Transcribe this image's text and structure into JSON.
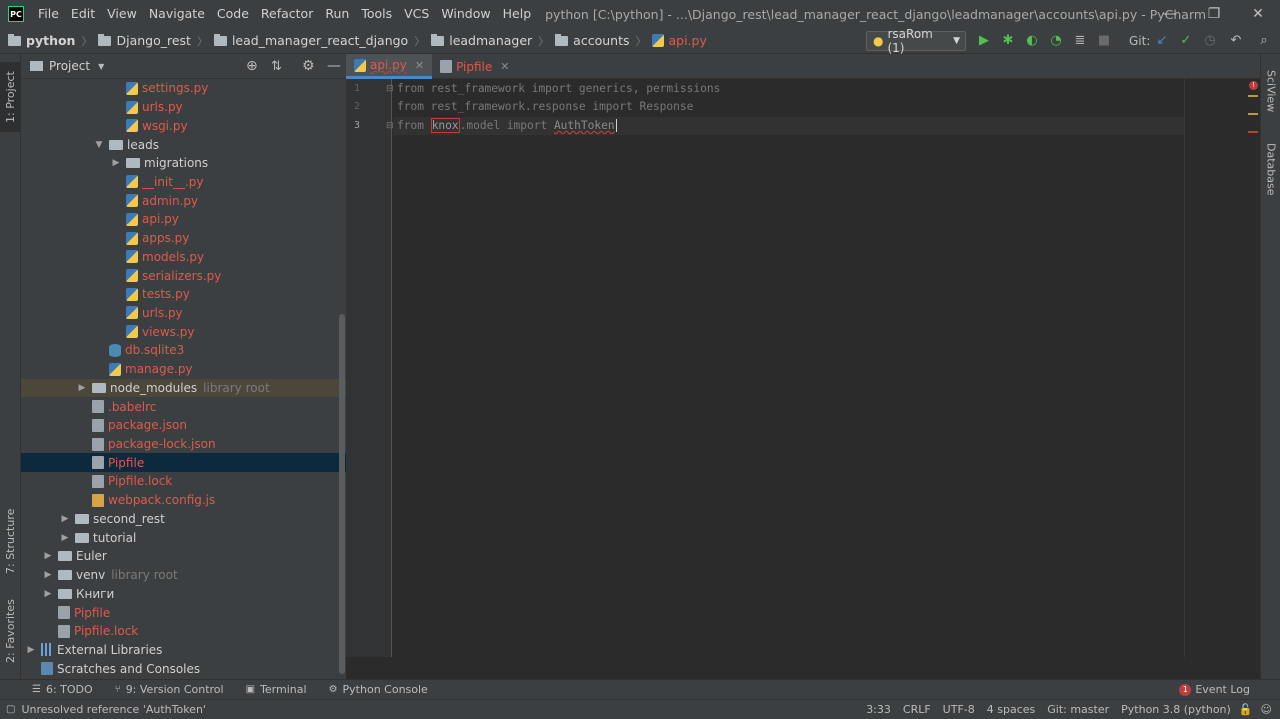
{
  "window": {
    "logo": "PC",
    "title": "python [C:\\python] - ...\\Django_rest\\lead_manager_react_django\\leadmanager\\accounts\\api.py - PyCharm",
    "minimize": "—",
    "restore": "❐",
    "close": "✕"
  },
  "menu": [
    "File",
    "Edit",
    "View",
    "Navigate",
    "Code",
    "Refactor",
    "Run",
    "Tools",
    "VCS",
    "Window",
    "Help"
  ],
  "breadcrumbs": [
    "python",
    "Django_rest",
    "lead_manager_react_django",
    "leadmanager",
    "accounts",
    "api.py"
  ],
  "toolbar": {
    "run_config": "rsaRom (1)",
    "git_label": "Git:"
  },
  "side_tabs": {
    "project": "1: Project",
    "structure": "7: Structure",
    "favorites": "2: Favorites",
    "sciview": "SciView",
    "database": "Database"
  },
  "project_panel": {
    "title": "Project"
  },
  "tree": [
    {
      "label": "settings.py",
      "icon": "py",
      "color": "red",
      "indent": 5,
      "arrow": ""
    },
    {
      "label": "urls.py",
      "icon": "py",
      "color": "red",
      "indent": 5,
      "arrow": ""
    },
    {
      "label": "wsgi.py",
      "icon": "py",
      "color": "red",
      "indent": 5,
      "arrow": ""
    },
    {
      "label": "leads",
      "icon": "folder",
      "color": "white",
      "indent": 4,
      "arrow": "▼"
    },
    {
      "label": "migrations",
      "icon": "folder",
      "color": "white",
      "indent": 5,
      "arrow": "▶"
    },
    {
      "label": "__init__.py",
      "icon": "py",
      "color": "red",
      "indent": 5,
      "arrow": ""
    },
    {
      "label": "admin.py",
      "icon": "py",
      "color": "red",
      "indent": 5,
      "arrow": ""
    },
    {
      "label": "api.py",
      "icon": "py",
      "color": "red",
      "indent": 5,
      "arrow": ""
    },
    {
      "label": "apps.py",
      "icon": "py",
      "color": "red",
      "indent": 5,
      "arrow": ""
    },
    {
      "label": "models.py",
      "icon": "py",
      "color": "red",
      "indent": 5,
      "arrow": ""
    },
    {
      "label": "serializers.py",
      "icon": "py",
      "color": "red",
      "indent": 5,
      "arrow": ""
    },
    {
      "label": "tests.py",
      "icon": "py",
      "color": "red",
      "indent": 5,
      "arrow": ""
    },
    {
      "label": "urls.py",
      "icon": "py",
      "color": "red",
      "indent": 5,
      "arrow": ""
    },
    {
      "label": "views.py",
      "icon": "py",
      "color": "red",
      "indent": 5,
      "arrow": ""
    },
    {
      "label": "db.sqlite3",
      "icon": "db",
      "color": "red",
      "indent": 4,
      "arrow": ""
    },
    {
      "label": "manage.py",
      "icon": "py",
      "color": "red",
      "indent": 4,
      "arrow": ""
    },
    {
      "label": "node_modules",
      "icon": "folder",
      "color": "white",
      "indent": 3,
      "arrow": "▶",
      "hint": "library root",
      "highlight": "lib"
    },
    {
      "label": ".babelrc",
      "icon": "file",
      "color": "red",
      "indent": 3,
      "arrow": ""
    },
    {
      "label": "package.json",
      "icon": "file",
      "color": "red",
      "indent": 3,
      "arrow": ""
    },
    {
      "label": "package-lock.json",
      "icon": "file",
      "color": "red",
      "indent": 3,
      "arrow": ""
    },
    {
      "label": "Pipfile",
      "icon": "file",
      "color": "red",
      "indent": 3,
      "arrow": "",
      "highlight": "selected"
    },
    {
      "label": "Pipfile.lock",
      "icon": "file",
      "color": "red",
      "indent": 3,
      "arrow": ""
    },
    {
      "label": "webpack.config.js",
      "icon": "js",
      "color": "red",
      "indent": 3,
      "arrow": ""
    },
    {
      "label": "second_rest",
      "icon": "folder",
      "color": "white",
      "indent": 2,
      "arrow": "▶"
    },
    {
      "label": "tutorial",
      "icon": "folder",
      "color": "white",
      "indent": 2,
      "arrow": "▶"
    },
    {
      "label": "Euler",
      "icon": "folder",
      "color": "white",
      "indent": 1,
      "arrow": "▶"
    },
    {
      "label": "venv",
      "icon": "folder",
      "color": "white",
      "indent": 1,
      "arrow": "▶",
      "hint": "library root"
    },
    {
      "label": "Книги",
      "icon": "folder",
      "color": "white",
      "indent": 1,
      "arrow": "▶"
    },
    {
      "label": "Pipfile",
      "icon": "file",
      "color": "red",
      "indent": 1,
      "arrow": ""
    },
    {
      "label": "Pipfile.lock",
      "icon": "file",
      "color": "red",
      "indent": 1,
      "arrow": ""
    },
    {
      "label": "External Libraries",
      "icon": "lib",
      "color": "white",
      "indent": 0,
      "arrow": "▶"
    },
    {
      "label": "Scratches and Consoles",
      "icon": "console",
      "color": "white",
      "indent": 0,
      "arrow": ""
    }
  ],
  "editor_tabs": [
    {
      "label": "api.py",
      "active": true,
      "close": "✕"
    },
    {
      "label": "Pipfile",
      "active": false,
      "close": "✕"
    }
  ],
  "code": {
    "line1": "from rest_framework import generics, permissions",
    "line2": "from rest_framework.response import Response",
    "line3_from": "from ",
    "line3_knox": "knox",
    "line3_mid": ".model import ",
    "line3_token": "AuthToken",
    "line_numbers": [
      "1",
      "2",
      "3"
    ]
  },
  "bottom_tools": [
    {
      "icon": "☰",
      "label": "6: TODO"
    },
    {
      "icon": "⑂",
      "label": "9: Version Control"
    },
    {
      "icon": "▣",
      "label": "Terminal"
    },
    {
      "icon": "⚙",
      "label": "Python Console"
    }
  ],
  "event_log": {
    "count": "1",
    "label": "Event Log"
  },
  "status": {
    "message": "Unresolved reference 'AuthToken'",
    "position": "3:33",
    "line_sep": "CRLF",
    "encoding": "UTF-8",
    "indent": "4 spaces",
    "git": "Git: master",
    "interpreter": "Python 3.8 (python)"
  },
  "colors": {
    "error": "#bc3f3c",
    "red_file": "#e0594a",
    "run_green": "#4fc14f",
    "accent_blue": "#4a88c7"
  }
}
